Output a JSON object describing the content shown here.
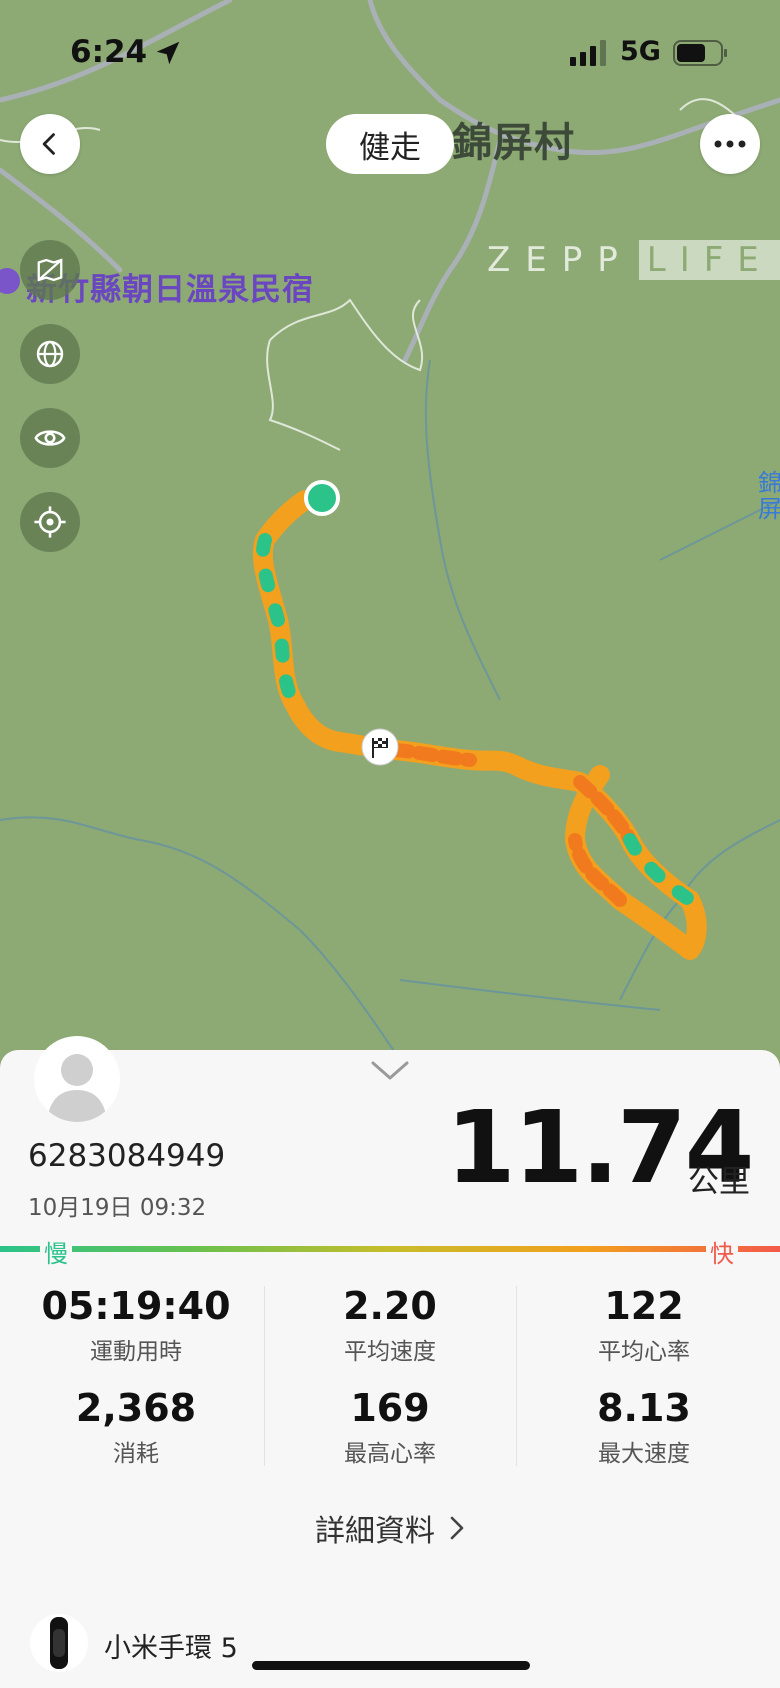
{
  "status_bar": {
    "time": "6:24",
    "network": "5G"
  },
  "header": {
    "activity_type": "健走"
  },
  "map": {
    "labels": {
      "village": "錦屏村",
      "poi": "新竹縣朝日溫泉民宿",
      "edge_text": "錦屏"
    },
    "watermark": {
      "zepp": "ZEPP",
      "life": "LIFE"
    },
    "route_colors": {
      "slow": "#2bc38a",
      "mid": "#f2a01e",
      "fast": "#f27a1e"
    }
  },
  "summary": {
    "user_id": "6283084949",
    "date": "10月19日 09:32",
    "distance": "11.74",
    "distance_unit": "公里",
    "slow_label": "慢",
    "fast_label": "快"
  },
  "stats": [
    {
      "value": "05:19:40",
      "label": "運動用時"
    },
    {
      "value": "2.20",
      "label": "平均速度"
    },
    {
      "value": "122",
      "label": "平均心率"
    },
    {
      "value": "2,368",
      "label": "消耗"
    },
    {
      "value": "169",
      "label": "最高心率"
    },
    {
      "value": "8.13",
      "label": "最大速度"
    }
  ],
  "detail_link": "詳細資料",
  "device": {
    "name": "小米手環 5"
  },
  "colors": {
    "map_bg": "#8daa74",
    "accent_green": "#2bc38a",
    "accent_red": "#f25a4a"
  }
}
